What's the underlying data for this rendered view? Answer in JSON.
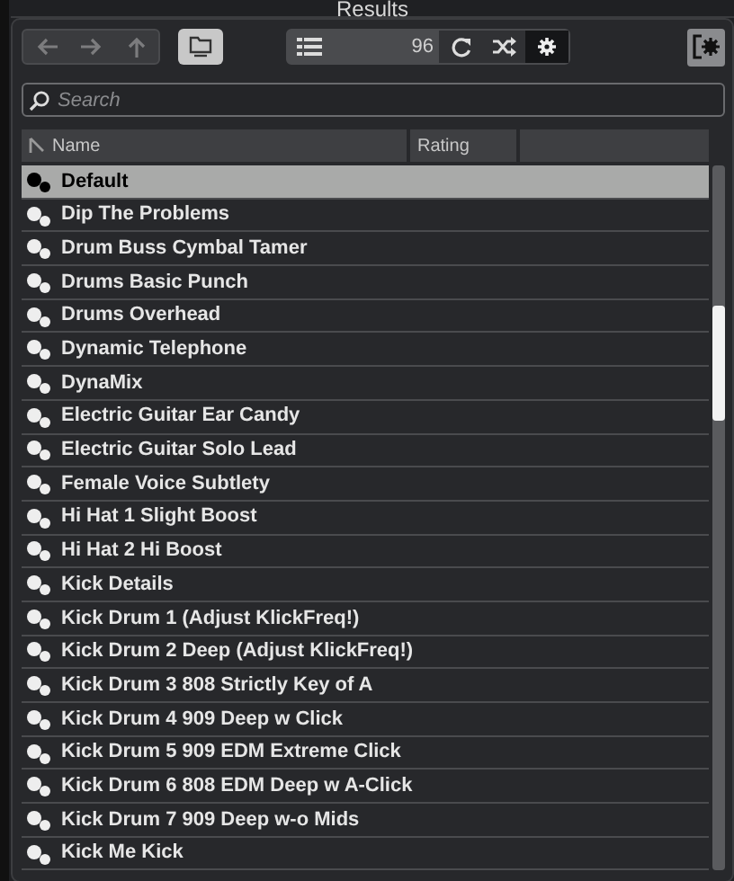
{
  "window": {
    "title": "Results"
  },
  "toolbar": {
    "nav_buttons": [
      {
        "kind": "back",
        "disabled": true
      },
      {
        "kind": "forward",
        "disabled": true
      },
      {
        "kind": "up",
        "disabled": true
      }
    ],
    "folder_button": {
      "on": true
    },
    "count": "96",
    "tools": [
      {
        "kind": "refresh",
        "selected": false
      },
      {
        "kind": "shuffle",
        "selected": false
      },
      {
        "kind": "settings",
        "selected": true
      }
    ]
  },
  "search": {
    "placeholder": "Search"
  },
  "table": {
    "columns": [
      "Name",
      "Rating"
    ],
    "rows": [
      {
        "name": "Default",
        "selected": true
      },
      {
        "name": "Dip The Problems",
        "selected": false
      },
      {
        "name": "Drum Buss Cymbal Tamer",
        "selected": false
      },
      {
        "name": "Drums Basic Punch",
        "selected": false
      },
      {
        "name": "Drums Overhead",
        "selected": false
      },
      {
        "name": "Dynamic Telephone",
        "selected": false
      },
      {
        "name": "DynaMix",
        "selected": false
      },
      {
        "name": "Electric Guitar Ear Candy",
        "selected": false
      },
      {
        "name": "Electric Guitar Solo Lead",
        "selected": false
      },
      {
        "name": "Female Voice Subtlety",
        "selected": false
      },
      {
        "name": "Hi Hat 1 Slight Boost",
        "selected": false
      },
      {
        "name": "Hi Hat 2 Hi Boost",
        "selected": false
      },
      {
        "name": "Kick Details",
        "selected": false
      },
      {
        "name": "Kick Drum 1 (Adjust KlickFreq!)",
        "selected": false
      },
      {
        "name": "Kick Drum 2 Deep (Adjust KlickFreq!)",
        "selected": false
      },
      {
        "name": "Kick Drum 3 808 Strictly Key of A",
        "selected": false
      },
      {
        "name": "Kick Drum 4 909 Deep w Click",
        "selected": false
      },
      {
        "name": "Kick Drum 5 909 EDM Extreme Click",
        "selected": false
      },
      {
        "name": "Kick Drum 6 808 EDM Deep w A-Click",
        "selected": false
      },
      {
        "name": "Kick Drum 7 909 Deep w-o Mids",
        "selected": false
      },
      {
        "name": "Kick Me Kick",
        "selected": false
      }
    ]
  }
}
